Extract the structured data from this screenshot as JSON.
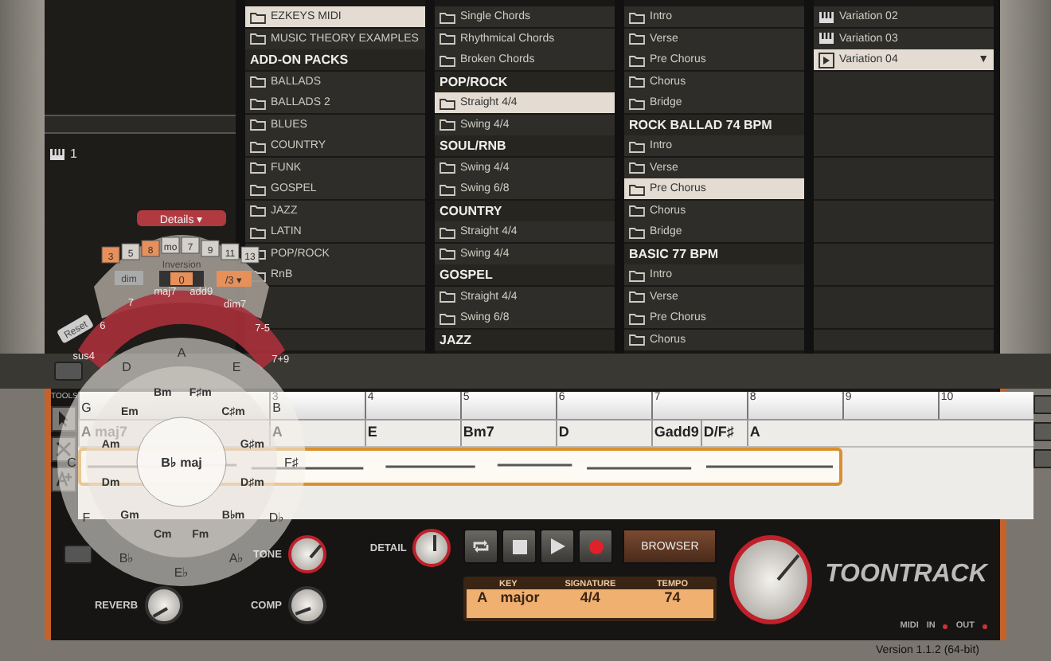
{
  "browser": {
    "left_list": [
      {
        "label": "1"
      }
    ],
    "columns": [
      [
        {
          "kind": "folder",
          "label": "EZKEYS MIDI",
          "selected": true
        },
        {
          "kind": "folder",
          "label": "MUSIC THEORY EXAMPLES",
          "selected": false
        },
        {
          "kind": "header",
          "label": "ADD-ON PACKS"
        },
        {
          "kind": "folder",
          "label": "BALLADS",
          "selected": false
        },
        {
          "kind": "folder",
          "label": "BALLADS 2",
          "selected": false
        },
        {
          "kind": "folder",
          "label": "BLUES",
          "selected": false
        },
        {
          "kind": "folder",
          "label": "COUNTRY",
          "selected": false
        },
        {
          "kind": "folder",
          "label": "FUNK",
          "selected": false
        },
        {
          "kind": "folder",
          "label": "GOSPEL",
          "selected": false
        },
        {
          "kind": "folder",
          "label": "JAZZ",
          "selected": false
        },
        {
          "kind": "folder",
          "label": "LATIN",
          "selected": false
        },
        {
          "kind": "folder",
          "label": "POP/ROCK",
          "selected": false
        },
        {
          "kind": "folder",
          "label": "RnB",
          "selected": false
        }
      ],
      [
        {
          "kind": "folder",
          "label": "Single Chords",
          "selected": false
        },
        {
          "kind": "folder",
          "label": "Rhythmical Chords",
          "selected": false
        },
        {
          "kind": "folder",
          "label": "Broken Chords",
          "selected": false
        },
        {
          "kind": "header",
          "label": "POP/ROCK"
        },
        {
          "kind": "folder",
          "label": "Straight 4/4",
          "selected": true
        },
        {
          "kind": "folder",
          "label": "Swing 4/4",
          "selected": false
        },
        {
          "kind": "header",
          "label": "SOUL/RNB"
        },
        {
          "kind": "folder",
          "label": "Swing 4/4",
          "selected": false
        },
        {
          "kind": "folder",
          "label": "Swing 6/8",
          "selected": false
        },
        {
          "kind": "header",
          "label": "COUNTRY"
        },
        {
          "kind": "folder",
          "label": "Straight 4/4",
          "selected": false
        },
        {
          "kind": "folder",
          "label": "Swing 4/4",
          "selected": false
        },
        {
          "kind": "header",
          "label": "GOSPEL"
        },
        {
          "kind": "folder",
          "label": "Straight 4/4",
          "selected": false
        },
        {
          "kind": "folder",
          "label": "Swing 6/8",
          "selected": false
        },
        {
          "kind": "header",
          "label": "JAZZ"
        }
      ],
      [
        {
          "kind": "folder",
          "label": "Intro",
          "selected": false
        },
        {
          "kind": "folder",
          "label": "Verse",
          "selected": false
        },
        {
          "kind": "folder",
          "label": "Pre Chorus",
          "selected": false
        },
        {
          "kind": "folder",
          "label": "Chorus",
          "selected": false
        },
        {
          "kind": "folder",
          "label": "Bridge",
          "selected": false
        },
        {
          "kind": "header",
          "label": "ROCK BALLAD 74 BPM"
        },
        {
          "kind": "folder",
          "label": "Intro",
          "selected": false
        },
        {
          "kind": "folder",
          "label": "Verse",
          "selected": false
        },
        {
          "kind": "folder",
          "label": "Pre Chorus",
          "selected": true
        },
        {
          "kind": "folder",
          "label": "Chorus",
          "selected": false
        },
        {
          "kind": "folder",
          "label": "Bridge",
          "selected": false
        },
        {
          "kind": "header",
          "label": "BASIC 77 BPM"
        },
        {
          "kind": "folder",
          "label": "Intro",
          "selected": false
        },
        {
          "kind": "folder",
          "label": "Verse",
          "selected": false
        },
        {
          "kind": "folder",
          "label": "Pre Chorus",
          "selected": false
        },
        {
          "kind": "folder",
          "label": "Chorus",
          "selected": false
        }
      ],
      [
        {
          "kind": "midi",
          "label": "Variation 02",
          "selected": false
        },
        {
          "kind": "midi",
          "label": "Variation 03",
          "selected": false
        },
        {
          "kind": "playing",
          "label": "Variation 04",
          "selected": true,
          "menu_mark": "▼"
        }
      ]
    ]
  },
  "wheel": {
    "details": "Details ▾",
    "tensions": [
      {
        "label": "3",
        "selected": true
      },
      {
        "label": "5",
        "selected": false
      },
      {
        "label": "8",
        "selected": true
      },
      {
        "label": "mo",
        "selected": false
      },
      {
        "label": "7",
        "selected": false
      },
      {
        "label": "9",
        "selected": false
      },
      {
        "label": "11",
        "selected": false
      },
      {
        "label": "13",
        "selected": false
      }
    ],
    "inversion_label": "Inversion",
    "inversion": "0",
    "dim": "dim",
    "bass": "/3 ▾",
    "reset": "Reset",
    "extensions": [
      "sus4",
      "6",
      "7",
      "maj7",
      "add9",
      "dim7",
      "7-5",
      "7+9"
    ],
    "majors": [
      "A",
      "E",
      "B",
      "F♯",
      "D♭",
      "A♭",
      "E♭",
      "B♭",
      "F",
      "C",
      "G",
      "D"
    ],
    "minors": [
      "F♯m",
      "C♯m",
      "G♯m",
      "D♯m",
      "B♭m",
      "Fm",
      "Cm",
      "Gm",
      "Dm",
      "Am",
      "Em",
      "Bm"
    ],
    "center": "B♭ maj"
  },
  "tools": {
    "title": "TOOLS",
    "items": [
      {
        "kind": "select"
      },
      {
        "kind": "cut"
      },
      {
        "kind": "chord"
      }
    ]
  },
  "timeline": {
    "lead_chord": "A maj7",
    "bars": [
      {
        "number": "3",
        "chords": [
          "A"
        ]
      },
      {
        "number": "4",
        "chords": [
          "E"
        ]
      },
      {
        "number": "5",
        "chords": [
          "Bm7"
        ]
      },
      {
        "number": "6",
        "chords": [
          "D"
        ]
      },
      {
        "number": "7",
        "chords": [
          "Gadd9",
          "D/F♯"
        ]
      },
      {
        "number": "8",
        "chords": [
          "A"
        ]
      },
      {
        "number": "9"
      },
      {
        "number": "10"
      }
    ]
  },
  "knobs": [
    {
      "label": "TONE"
    },
    {
      "label": "DETAIL"
    },
    {
      "label": "REVERB"
    },
    {
      "label": "COMP"
    }
  ],
  "transport": [
    {
      "kind": "loop"
    },
    {
      "kind": "stop"
    },
    {
      "kind": "play"
    },
    {
      "kind": "record"
    }
  ],
  "browser_button": "BROWSER",
  "display": [
    {
      "label": "KEY",
      "value": "A major"
    },
    {
      "label": "SIGNATURE",
      "value": "4/4"
    },
    {
      "label": "TEMPO",
      "value": "74"
    }
  ],
  "logo": "TOONTRACK",
  "midi": {
    "label": "MIDI",
    "in": "IN",
    "out": "OUT"
  },
  "version": "Version 1.1.2 (64-bit)"
}
